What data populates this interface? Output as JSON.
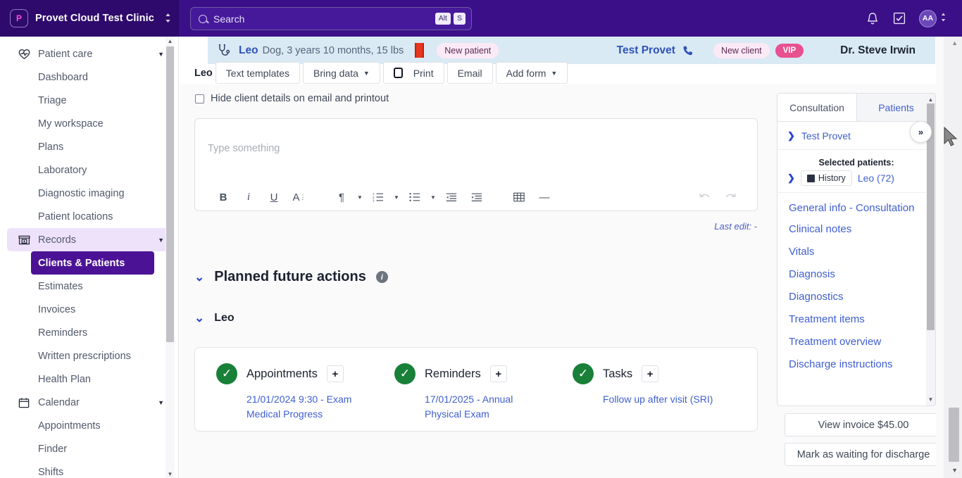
{
  "topbar": {
    "brand_initial": "P",
    "brand_name": "Provet Cloud Test Clinic",
    "search_placeholder": "Search",
    "kbd_alt": "Alt",
    "kbd_s": "S",
    "avatar_initials": "AA",
    "icons": [
      "bell-icon",
      "tasks-checkbox-icon",
      "avatar"
    ]
  },
  "sidebar": {
    "groups": [
      {
        "label": "Patient care",
        "icon": "heartbeat-icon",
        "expanded": true,
        "items": [
          "Dashboard",
          "Triage",
          "My workspace",
          "Plans",
          "Laboratory",
          "Diagnostic imaging",
          "Patient locations"
        ]
      },
      {
        "label": "Records",
        "icon": "records-box-icon",
        "expanded": true,
        "active": true,
        "items": [
          "Clients & Patients",
          "Estimates",
          "Invoices",
          "Reminders",
          "Written prescriptions",
          "Health Plan"
        ],
        "selected": "Clients & Patients"
      },
      {
        "label": "Calendar",
        "icon": "calendar-icon",
        "expanded": true,
        "items": [
          "Appointments",
          "Finder",
          "Shifts"
        ]
      }
    ]
  },
  "banner": {
    "patient_name": "Leo",
    "patient_info": "Dog, 3 years 10 months, 15 lbs",
    "new_patient_badge": "New patient",
    "client_name": "Test Provet",
    "new_client_badge": "New client",
    "vip_badge": "VIP",
    "vet_name": "Dr. Steve Irwin"
  },
  "actionbar": {
    "record_label": "Leo",
    "buttons": [
      {
        "label": "Text templates",
        "caret": false,
        "icon": null
      },
      {
        "label": "Bring data",
        "caret": true,
        "icon": null
      },
      {
        "label": "Print",
        "caret": false,
        "icon": "printer-icon"
      },
      {
        "label": "Email",
        "caret": false,
        "icon": null
      },
      {
        "label": "Add form",
        "caret": true,
        "icon": null
      }
    ]
  },
  "main": {
    "hide_client_details_label": "Hide client details on email and printout",
    "editor_placeholder": "Type something",
    "editor_tools": [
      "bold",
      "italic",
      "underline",
      "font-size",
      "paragraph",
      "ordered-list",
      "bullet-list",
      "outdent",
      "indent",
      "table",
      "horizontal-rule",
      "undo",
      "redo"
    ],
    "last_edit": "Last edit: -",
    "section_title": "Planned future actions",
    "subsection_title": "Leo",
    "cards": [
      {
        "title": "Appointments",
        "status": "complete",
        "add_label": "+",
        "detail": "21/01/2024 9:30 - Exam Medical Progress"
      },
      {
        "title": "Reminders",
        "status": "complete",
        "add_label": "+",
        "detail": "17/01/2025 - Annual Physical Exam"
      },
      {
        "title": "Tasks",
        "status": "complete",
        "add_label": "+",
        "detail": "Follow up after visit (SRI)"
      }
    ]
  },
  "right_panel": {
    "tabs": [
      {
        "label": "Consultation",
        "active": true
      },
      {
        "label": "Patients",
        "active": false
      }
    ],
    "client_row": "Test Provet",
    "selected_patients_label": "Selected patients:",
    "history_button": "History",
    "patient_entry": "Leo (72)",
    "links": [
      "General info - Consultation",
      "Clinical notes",
      "Vitals",
      "Diagnosis",
      "Diagnostics",
      "Treatment items",
      "Treatment overview",
      "Discharge instructions"
    ],
    "expand_button": "»",
    "view_invoice": "View invoice $45.00",
    "mark_waiting": "Mark as waiting for discharge"
  },
  "colors": {
    "brand_purple": "#3b0f87",
    "brand_purple_dark": "#2d0a6b",
    "selected_nav": "#4b1295",
    "active_group": "#eee2fb",
    "banner_blue": "#d9eaf5",
    "link_blue": "#3f5fd0",
    "success_green": "#188038",
    "vip_pink": "#e8518f",
    "flag_red": "#e8361c"
  }
}
